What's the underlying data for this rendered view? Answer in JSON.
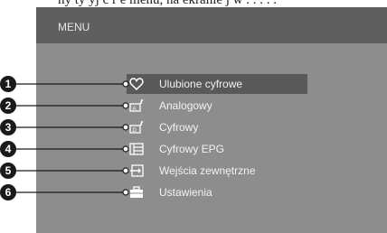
{
  "top_text": "ny ty yj c  r e  menu, na ekranie  j  w  . . . . .",
  "menu": {
    "title": "MENU",
    "items": [
      {
        "label": "Ulubione cyfrowe",
        "icon": "heart-icon",
        "selected": true
      },
      {
        "label": "Analogowy",
        "icon": "tv-antenna-analog-icon",
        "selected": false
      },
      {
        "label": "Cyfrowy",
        "icon": "tv-antenna-digital-icon",
        "selected": false
      },
      {
        "label": "Cyfrowy EPG",
        "icon": "epg-grid-icon",
        "selected": false
      },
      {
        "label": "Wejścia zewnętrzne",
        "icon": "input-arrow-icon",
        "selected": false
      },
      {
        "label": "Ustawienia",
        "icon": "toolbox-icon",
        "selected": false
      }
    ]
  },
  "callouts": [
    "1",
    "2",
    "3",
    "4",
    "5",
    "6"
  ]
}
